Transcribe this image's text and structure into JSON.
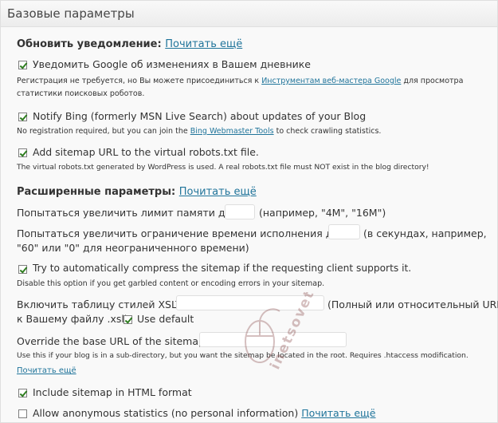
{
  "header": {
    "title": "Базовые параметры"
  },
  "notify_section": {
    "heading": "Обновить уведомление:",
    "read_more": "Почитать ещё"
  },
  "google": {
    "checked": true,
    "label": "Уведомить Google об изменениях в Вашем дневнике",
    "note_before": "Регистрация не требуется, но Вы можете присоединиться к ",
    "note_link": "Инструментам веб-мастера Google",
    "note_after": " для просмотра",
    "note_line2": "статистики поисковых роботов."
  },
  "bing": {
    "checked": true,
    "label": "Notify Bing (formerly MSN Live Search) about updates of your Blog",
    "note_before": "No registration required, but you can join the ",
    "note_link": "Bing Webmaster Tools",
    "note_after": " to check crawling statistics."
  },
  "robots": {
    "checked": true,
    "label": "Add sitemap URL to the virtual robots.txt file.",
    "note": "The virtual robots.txt generated by WordPress is used. A real robots.txt file must NOT exist in the blog directory!"
  },
  "advanced_section": {
    "heading": "Расширенные параметры:",
    "read_more": "Почитать ещё"
  },
  "memory": {
    "label": "Попытаться увеличить лимит памяти до:",
    "value": "",
    "hint": "(например, \"4M\", \"16M\")"
  },
  "exec_time": {
    "label": "Попытаться увеличить ограничение времени исполнения до:",
    "value": "",
    "hint_line1": "(в секундах, например,",
    "hint_line2": "\"60\" или \"0\" для неограниченного времени)"
  },
  "compress": {
    "checked": true,
    "label": "Try to automatically compress the sitemap if the requesting client supports it.",
    "note": "Disable this option if you get garbled content or encoding errors in your sitemap."
  },
  "xslt": {
    "label": "Включить таблицу стилей XSLT:",
    "value": "",
    "hint_line1": "(Полный или относительный URL",
    "hint_line2": "к Вашему файлу .xsl)",
    "use_default_checked": true,
    "use_default_label": "Use default"
  },
  "base_url": {
    "label": "Override the base URL of the sitemap:",
    "value": "",
    "note": "Use this if your blog is in a sub-directory, but you want the sitemap be located in the root. Requires .htaccess modification.",
    "read_more": "Почитать ещё"
  },
  "html_format": {
    "checked": true,
    "label": "Include sitemap in HTML format"
  },
  "anon_stats": {
    "checked": false,
    "label": "Allow anonymous statistics (no personal information)",
    "read_more": "Почитать ещё"
  },
  "watermark": {
    "text": "inetsovety.ru",
    "icon": "mouse-icon"
  },
  "colors": {
    "link": "#21759b",
    "check": "#2e7d1f",
    "border": "#dfdfdf"
  }
}
